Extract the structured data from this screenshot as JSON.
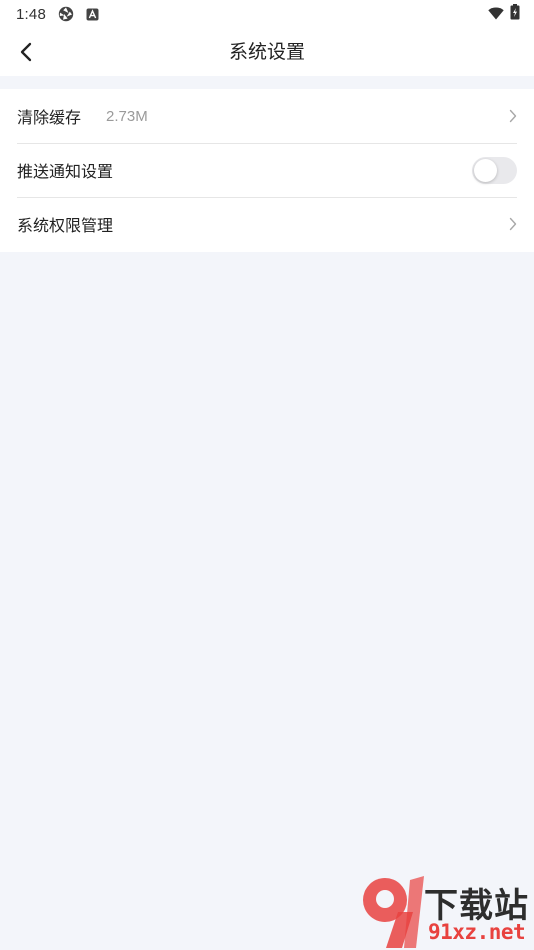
{
  "status_bar": {
    "time": "1:48"
  },
  "app_bar": {
    "title": "系统设置"
  },
  "settings": [
    {
      "label": "清除缓存",
      "value": "2.73M",
      "control": "chevron-right-icon"
    },
    {
      "label": "推送通知设置",
      "control": "toggle",
      "enabled": false
    },
    {
      "label": "系统权限管理",
      "control": "chevron-right-icon"
    }
  ],
  "watermark": {
    "brand_text": "下载站",
    "url_text": "91xz.net",
    "logo_glyph": "9"
  },
  "colors": {
    "page_background": "#f3f5fa",
    "card_background": "#ffffff",
    "secondary_text": "#9a9a9a",
    "toggle_off": "#e9e9ec",
    "watermark_red": "#e8423f"
  }
}
